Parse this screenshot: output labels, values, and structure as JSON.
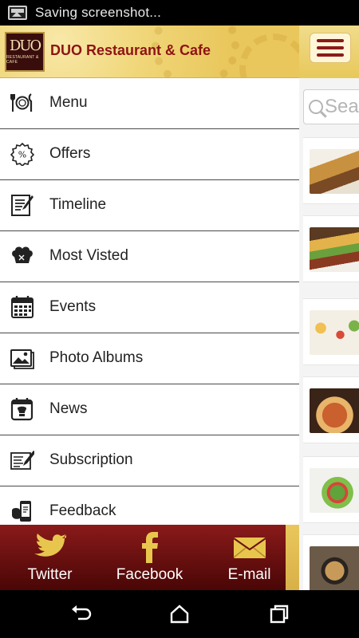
{
  "status_bar": {
    "notification_icon": "screenshot-icon",
    "text": "Saving screenshot..."
  },
  "drawer": {
    "logo": {
      "mark": "DUO",
      "sub": "RESTAURANT & CAFE"
    },
    "title": "DUO Restaurant & Cafe",
    "items": [
      {
        "label": "Menu",
        "icon": "plate-cutlery-icon"
      },
      {
        "label": "Offers",
        "icon": "percent-badge-icon"
      },
      {
        "label": "Timeline",
        "icon": "timeline-edit-icon"
      },
      {
        "label": "Most Visted",
        "icon": "chef-hat-icon"
      },
      {
        "label": "Events",
        "icon": "calendar-icon"
      },
      {
        "label": "Photo Albums",
        "icon": "photo-album-icon"
      },
      {
        "label": "News",
        "icon": "news-calendar-icon"
      },
      {
        "label": "Subscription",
        "icon": "subscription-pen-icon"
      },
      {
        "label": "Feedback",
        "icon": "feedback-phone-icon"
      }
    ]
  },
  "social": [
    {
      "label": "Twitter",
      "icon": "twitter-bird-icon"
    },
    {
      "label": "Facebook",
      "icon": "facebook-f-icon"
    },
    {
      "label": "E-mail",
      "icon": "email-envelope-icon"
    }
  ],
  "main": {
    "menu_button_icon": "hamburger-menu-icon",
    "search_placeholder": "Sea",
    "thumbnails": [
      "breakfast-photo",
      "burger-photo",
      "canapes-photo",
      "pizza-photo",
      "salad-photo",
      "soup-photo"
    ]
  },
  "nav_bar": {
    "back": "back-icon",
    "home": "home-icon",
    "recents": "recents-icon"
  },
  "colors": {
    "brand_red": "#8e1414",
    "header_gold": "#e9c75c",
    "social_bar": "#6a1010"
  }
}
